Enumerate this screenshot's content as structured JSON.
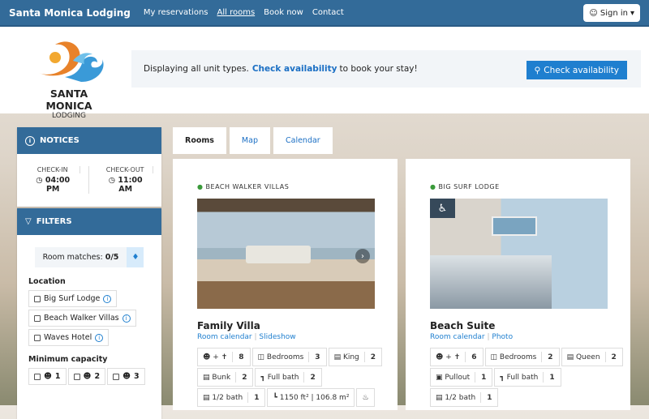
{
  "nav": {
    "brand": "Santa Monica Lodging",
    "links": [
      "My reservations",
      "All rooms",
      "Book now",
      "Contact"
    ],
    "signin": "Sign in"
  },
  "header": {
    "logo_line1": "SANTA MONICA",
    "logo_line2": "LODGING",
    "banner_text": "Displaying all unit types.",
    "banner_link": "Check availability",
    "banner_suffix": "to book your stay!",
    "button": "Check availability"
  },
  "notices": {
    "title": "NOTICES",
    "checkin_label": "CHECK-IN",
    "checkin": "04:00 PM",
    "checkout_label": "CHECK-OUT",
    "checkout": "11:00 AM"
  },
  "filters": {
    "title": "FILTERS",
    "matches_label": "Room matches:",
    "matches": "0/5",
    "location_label": "Location",
    "locations": [
      "Big Surf Lodge",
      "Beach Walker Villas",
      "Waves Hotel"
    ],
    "capacity_label": "Minimum capacity",
    "capacities": [
      "1",
      "2",
      "3"
    ]
  },
  "tabs": [
    "Rooms",
    "Map",
    "Calendar"
  ],
  "rooms": [
    {
      "location": "BEACH WALKER VILLAS",
      "name": "Family Villa",
      "link1": "Room calendar",
      "link2": "Slideshow",
      "features": [
        {
          "label": "+",
          "value": "8",
          "icon": "guests-icon"
        },
        {
          "label": "Bedrooms",
          "value": "3",
          "icon": "door-icon"
        },
        {
          "label": "King",
          "value": "2",
          "icon": "bed-icon"
        },
        {
          "label": "Bunk",
          "value": "2",
          "icon": "bunk-icon"
        },
        {
          "label": "Full bath",
          "value": "2",
          "icon": "bath-icon"
        },
        {
          "label": "1/2 bath",
          "value": "1",
          "icon": "toilet-icon"
        },
        {
          "label": "1150 ft² | 106.8 m²",
          "value": "",
          "icon": "area-icon"
        }
      ]
    },
    {
      "location": "BIG SURF LODGE",
      "name": "Beach Suite",
      "link1": "Room calendar",
      "link2": "Photo",
      "features": [
        {
          "label": "+",
          "value": "6",
          "icon": "guests-icon"
        },
        {
          "label": "Bedrooms",
          "value": "2",
          "icon": "door-icon"
        },
        {
          "label": "Queen",
          "value": "2",
          "icon": "bed-icon"
        },
        {
          "label": "Pullout",
          "value": "1",
          "icon": "sofa-icon"
        },
        {
          "label": "Full bath",
          "value": "1",
          "icon": "bath-icon"
        },
        {
          "label": "1/2 bath",
          "value": "1",
          "icon": "toilet-icon"
        }
      ]
    }
  ]
}
